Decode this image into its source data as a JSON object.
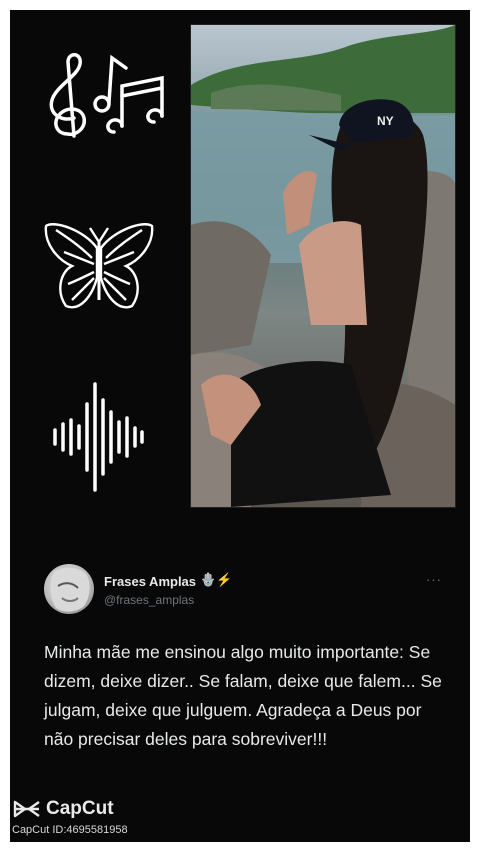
{
  "tweet": {
    "author_name": "Frases Amplas",
    "author_badges": "🪬⚡",
    "handle": "@frases_amplas",
    "more": "···",
    "text": "Minha mãe me ensinou algo muito importante: Se dizem, deixe dizer.. Se falam, deixe que falem... Se julgam, deixe que julguem. Agradeça a Deus por não precisar deles para sobreviver!!!"
  },
  "watermark": {
    "brand": "CapCut",
    "id": "CapCut ID:4695581958"
  },
  "icons": [
    "music-notes-icon",
    "butterfly-icon",
    "sound-wave-icon"
  ],
  "colors": {
    "background": "#080808",
    "text": "#e7e9ea",
    "muted": "#71767b"
  }
}
